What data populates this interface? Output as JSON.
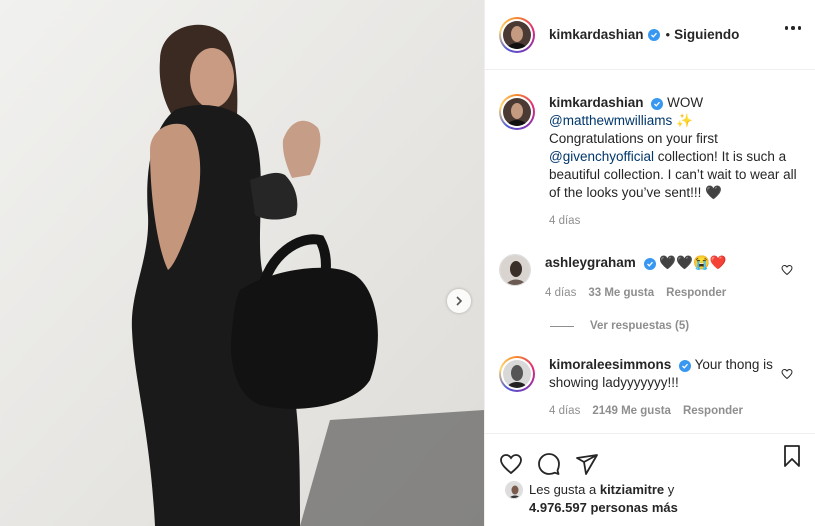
{
  "post": {
    "username": "kimkardashian",
    "follow_separator": "•",
    "follow_status": "Siguiendo"
  },
  "caption": {
    "username": "kimkardashian",
    "text_1": "WOW",
    "mention_1": "@matthewmwilliams",
    "sparkle": "✨",
    "text_2": "Congratulations on your first",
    "mention_2": "@givenchyofficial",
    "text_3": "collection! It is such a beautiful collection. I can’t wait to wear all of the looks you’ve sent!!! 🖤",
    "time": "4 días"
  },
  "comments": [
    {
      "username": "ashleygraham",
      "text": "🖤🖤😭❤️",
      "time": "4 días",
      "likes": "33 Me gusta",
      "reply": "Responder"
    },
    {
      "username": "kimoraleesimmons",
      "text": "Your thong is showing ladyyyyyyy!!!",
      "time": "4 días",
      "likes": "2149 Me gusta",
      "reply": "Responder"
    }
  ],
  "view_replies": "Ver respuestas (5)",
  "likes": {
    "prefix": "Les gusta a",
    "user": "kitziamitre",
    "and": "y",
    "count": "4.976.597 personas más"
  },
  "icons": [
    "heart-icon",
    "comment-icon",
    "share-icon",
    "bookmark-icon",
    "more-options-icon",
    "chevron-right-icon",
    "verified-icon"
  ],
  "colors": {
    "verified": "#3897f0",
    "link": "#00376b",
    "muted": "#8e8e8e"
  }
}
